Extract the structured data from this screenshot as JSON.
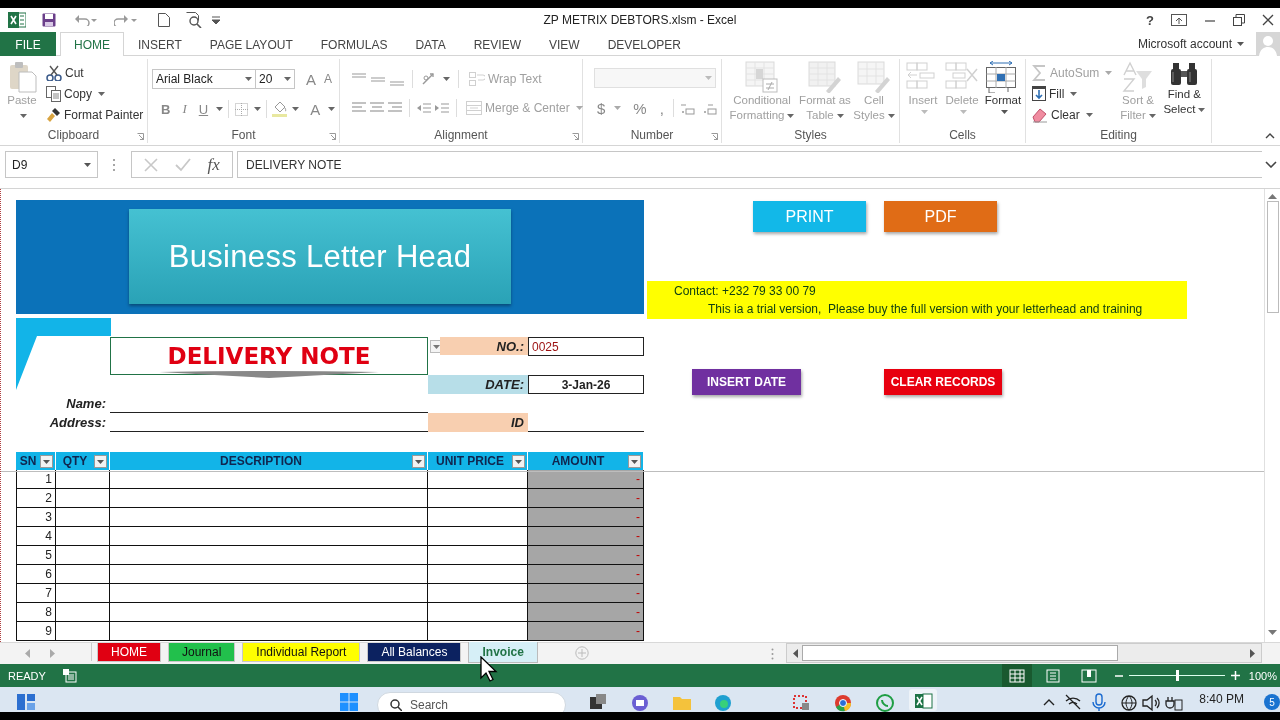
{
  "title_bar": {
    "title": "ZP METRIX DEBTORS.xlsm - Excel",
    "help": "?"
  },
  "account": {
    "label": "Microsoft account"
  },
  "ribbon_tabs": [
    {
      "label": "FILE",
      "kind": "file",
      "selected": false
    },
    {
      "label": "HOME",
      "kind": "tab",
      "selected": true
    },
    {
      "label": "INSERT",
      "kind": "tab",
      "selected": false
    },
    {
      "label": "PAGE LAYOUT",
      "kind": "tab",
      "selected": false
    },
    {
      "label": "FORMULAS",
      "kind": "tab",
      "selected": false
    },
    {
      "label": "DATA",
      "kind": "tab",
      "selected": false
    },
    {
      "label": "REVIEW",
      "kind": "tab",
      "selected": false
    },
    {
      "label": "VIEW",
      "kind": "tab",
      "selected": false
    },
    {
      "label": "DEVELOPER",
      "kind": "tab",
      "selected": false
    }
  ],
  "ribbon": {
    "clipboard": {
      "label": "Clipboard",
      "paste": {
        "label": "Paste",
        "disabled": true
      },
      "cut": {
        "label": "Cut",
        "disabled": false
      },
      "copy": {
        "label": "Copy",
        "disabled": false
      },
      "format_painter": {
        "label": "Format Painter",
        "disabled": false
      }
    },
    "font": {
      "label": "Font",
      "font_name": "Arial Black",
      "font_size": "20",
      "grow_font": "A",
      "shrink_font": "A",
      "bold": "B",
      "italic": "I",
      "underline": "U",
      "font_color": "A"
    },
    "alignment": {
      "label": "Alignment",
      "wrap_text": {
        "label": "Wrap Text",
        "disabled": true
      },
      "merge_center": {
        "label": "Merge & Center",
        "disabled": true
      }
    },
    "number": {
      "label": "Number",
      "currency": "$",
      "percent": "%",
      "comma": ","
    },
    "styles": {
      "label": "Styles",
      "buttons": [
        {
          "label": "Conditional Formatting",
          "disabled": true
        },
        {
          "label": "Format as Table",
          "disabled": true
        },
        {
          "label": "Cell Styles",
          "disabled": true
        }
      ]
    },
    "cells": {
      "label": "Cells",
      "buttons": [
        {
          "label": "Insert",
          "disabled": true
        },
        {
          "label": "Delete",
          "disabled": true
        },
        {
          "label": "Format",
          "disabled": false
        }
      ]
    },
    "editing": {
      "label": "Editing",
      "autosum": {
        "label": "AutoSum",
        "disabled": true
      },
      "fill": {
        "label": "Fill",
        "disabled": false
      },
      "clear": {
        "label": "Clear",
        "disabled": false
      },
      "sort_filter": {
        "label": "Sort & Filter",
        "disabled": true
      },
      "find_select": {
        "label": "Find & Select",
        "disabled": false
      }
    }
  },
  "formula_bar": {
    "name_box": "D9",
    "function_label": "fx",
    "formula": "DELIVERY NOTE"
  },
  "sheet": {
    "letterhead": "Business Letter Head",
    "buttons": [
      {
        "label": "PRINT",
        "color": "#12b8e8"
      },
      {
        "label": "PDF",
        "color": "#e06c16"
      },
      {
        "label": "INSERT DATE",
        "color": "#7030a0"
      },
      {
        "label": "CLEAR RECORDS",
        "color": "#e8000f"
      }
    ],
    "notice": {
      "contact": "Contact: +232 79 33 00 79",
      "message": "This ia a trial version,  Please buy the full version with your letterhead and training"
    },
    "form": {
      "title": "DELIVERY NOTE",
      "number_label": "NO.:",
      "number": "0025",
      "date_label": "DATE:",
      "date": "3-Jan-26",
      "name_label": "Name:",
      "address_label": "Address:",
      "id_label": "ID"
    },
    "table": {
      "columns": [
        "SN",
        "QTY",
        "DESCRIPTION",
        "UNIT PRICE",
        "AMOUNT"
      ],
      "rows": [
        {
          "sn": "1",
          "amount": "-"
        },
        {
          "sn": "2",
          "amount": "-"
        },
        {
          "sn": "3",
          "amount": "-"
        },
        {
          "sn": "4",
          "amount": "-"
        },
        {
          "sn": "5",
          "amount": "-"
        },
        {
          "sn": "6",
          "amount": "-"
        },
        {
          "sn": "7",
          "amount": "-"
        },
        {
          "sn": "8",
          "amount": "-"
        },
        {
          "sn": "9",
          "amount": "-"
        }
      ]
    }
  },
  "sheet_tabs": [
    {
      "label": "HOME",
      "color": "#e00012",
      "selected": false
    },
    {
      "label": "Journal",
      "color": "#22c04c",
      "selected": false
    },
    {
      "label": "Individual Report",
      "color": "#ffff00",
      "selected": false
    },
    {
      "label": "All Balances",
      "color": "#0c2260",
      "selected": false
    },
    {
      "label": "Invoice",
      "color": "#d6eff7",
      "selected": true
    }
  ],
  "status_bar": {
    "mode": "READY",
    "views": [
      {
        "selected": true
      },
      {
        "selected": false
      },
      {
        "selected": false
      }
    ],
    "zoom": {
      "level": 0.5,
      "label": "100%"
    }
  },
  "taskbar": {
    "search_placeholder": "Search",
    "time": "8:40 PM",
    "notification_count": "5"
  }
}
